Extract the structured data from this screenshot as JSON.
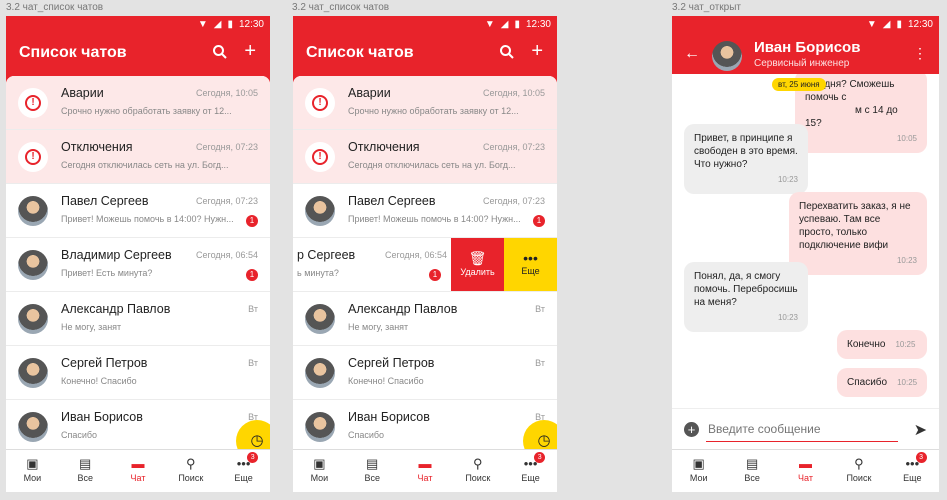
{
  "screen1": {
    "label": "3.2 чат_список чатов"
  },
  "screen2": {
    "label": "3.2 чат_список чатов"
  },
  "screen3": {
    "label": "3.2 чат_открыт"
  },
  "status": {
    "time": "12:30"
  },
  "list": {
    "title": "Список чатов",
    "rows": [
      {
        "name": "Аварии",
        "time": "Сегодня, 10:05",
        "preview": "Срочно нужно обработать заявку от 12...",
        "badge": ""
      },
      {
        "name": "Отключения",
        "time": "Сегодня, 07:23",
        "preview": "Сегодня отключилась сеть на ул. Богд...",
        "badge": ""
      },
      {
        "name": "Павел Сергеев",
        "time": "Сегодня, 07:23",
        "preview": "Привет! Можешь помочь в 14:00? Нужн...",
        "badge": "1"
      },
      {
        "name": "Владимир Сергеев",
        "time": "Сегодня, 06:54",
        "preview": "Привет! Есть минута?",
        "badge": "1"
      },
      {
        "name": "Александр Павлов",
        "time": "Вт",
        "preview": "Не могу, занят",
        "badge": ""
      },
      {
        "name": "Сергей Петров",
        "time": "Вт",
        "preview": "Конечно! Спасибо",
        "badge": ""
      },
      {
        "name": "Иван Борисов",
        "time": "Вт",
        "preview": "Спасибо",
        "badge": ""
      }
    ],
    "swiped_name": "р Сергеев",
    "swiped_preview": "ь минута?",
    "swipe_delete": "Удалить",
    "swipe_more": "Еще"
  },
  "nav": {
    "items": [
      "Мои",
      "Все",
      "Чат",
      "Поиск",
      "Еще"
    ],
    "badge": "3"
  },
  "chat": {
    "contact_name": "Иван Борисов",
    "contact_role": "Сервисный инженер",
    "date_chip": "вт, 25 июня",
    "messages": [
      {
        "dir": "out",
        "text": "сегодня? Сможешь помочь с",
        "text2": "м с 14 до 15?",
        "time": "10:05"
      },
      {
        "dir": "in",
        "text": "Привет, в принципе я свободен в это время. Что нужно?",
        "time": "10:23"
      },
      {
        "dir": "out",
        "text": "Перехватить заказ, я не успеваю. Там все просто, только подключение вифи",
        "time": "10:23"
      },
      {
        "dir": "in",
        "text": "Понял, да, я смогу помочь. Перебросишь на меня?",
        "time": "10:23"
      },
      {
        "dir": "out",
        "text": "Конечно",
        "time": "10:25"
      },
      {
        "dir": "out",
        "text": "Спасибо",
        "time": "10:25"
      }
    ],
    "input_placeholder": "Введите сообщение"
  }
}
